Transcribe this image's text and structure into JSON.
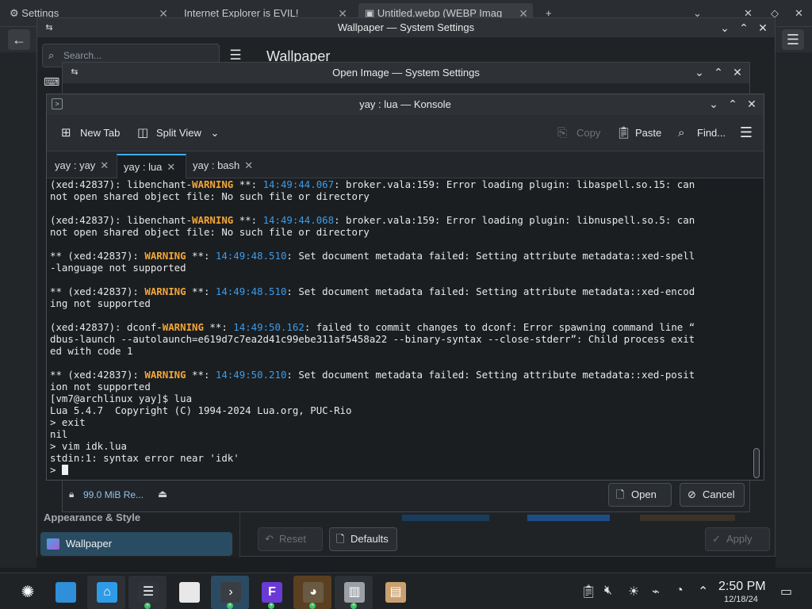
{
  "browser": {
    "tabs": [
      "Settings",
      "Internet Explorer is EVIL!",
      "Untitled.webp (WEBP Imag"
    ],
    "new_tab_label": "+"
  },
  "settings_window": {
    "title": "Wallpaper — System Settings",
    "search_placeholder": "Search...",
    "heading": "Wallpaper",
    "sidebar_category": "Appearance & Style",
    "sidebar_item": "Wallpaper",
    "reset_label": "Reset",
    "defaults_label": "Defaults",
    "apply_label": "Apply"
  },
  "open_dialog": {
    "title": "Open Image — System Settings",
    "status": "99.0 MiB Re...",
    "open_label": "Open",
    "cancel_label": "Cancel"
  },
  "konsole": {
    "title": "yay : lua — Konsole",
    "toolbar": {
      "new_tab": "New Tab",
      "split_view": "Split View",
      "copy": "Copy",
      "paste": "Paste",
      "find": "Find..."
    },
    "tabs": [
      "yay : yay",
      "yay : lua",
      "yay : bash"
    ],
    "active_tab": 1,
    "terminal": [
      [
        {
          "t": "(xed:42837): libenchant-",
          "c": ""
        },
        {
          "t": "WARNING",
          "c": "warn"
        },
        {
          "t": " **: ",
          "c": ""
        },
        {
          "t": "14:49:44.067",
          "c": "time"
        },
        {
          "t": ": broker.vala:159: Error loading plugin: libaspell.so.15: can",
          "c": ""
        }
      ],
      [
        {
          "t": "not open shared object file: No such file or directory",
          "c": ""
        }
      ],
      [],
      [
        {
          "t": "(xed:42837): libenchant-",
          "c": ""
        },
        {
          "t": "WARNING",
          "c": "warn"
        },
        {
          "t": " **: ",
          "c": ""
        },
        {
          "t": "14:49:44.068",
          "c": "time"
        },
        {
          "t": ": broker.vala:159: Error loading plugin: libnuspell.so.5: can",
          "c": ""
        }
      ],
      [
        {
          "t": "not open shared object file: No such file or directory",
          "c": ""
        }
      ],
      [],
      [
        {
          "t": "** (xed:42837): ",
          "c": ""
        },
        {
          "t": "WARNING",
          "c": "warn"
        },
        {
          "t": " **: ",
          "c": ""
        },
        {
          "t": "14:49:48.510",
          "c": "time"
        },
        {
          "t": ": Set document metadata failed: Setting attribute metadata::xed-spell",
          "c": ""
        }
      ],
      [
        {
          "t": "-language not supported",
          "c": ""
        }
      ],
      [],
      [
        {
          "t": "** (xed:42837): ",
          "c": ""
        },
        {
          "t": "WARNING",
          "c": "warn"
        },
        {
          "t": " **: ",
          "c": ""
        },
        {
          "t": "14:49:48.510",
          "c": "time"
        },
        {
          "t": ": Set document metadata failed: Setting attribute metadata::xed-encod",
          "c": ""
        }
      ],
      [
        {
          "t": "ing not supported",
          "c": ""
        }
      ],
      [],
      [
        {
          "t": "(xed:42837): dconf-",
          "c": ""
        },
        {
          "t": "WARNING",
          "c": "warn"
        },
        {
          "t": " **: ",
          "c": ""
        },
        {
          "t": "14:49:50.162",
          "c": "time"
        },
        {
          "t": ": failed to commit changes to dconf: Error spawning command line “",
          "c": ""
        }
      ],
      [
        {
          "t": "dbus-launch --autolaunch=e619d7c7ea2d41c99ebe311af5458a22 --binary-syntax --close-stderr”: Child process exit",
          "c": ""
        }
      ],
      [
        {
          "t": "ed with code 1",
          "c": ""
        }
      ],
      [],
      [
        {
          "t": "** (xed:42837): ",
          "c": ""
        },
        {
          "t": "WARNING",
          "c": "warn"
        },
        {
          "t": " **: ",
          "c": ""
        },
        {
          "t": "14:49:50.210",
          "c": "time"
        },
        {
          "t": ": Set document metadata failed: Setting attribute metadata::xed-posit",
          "c": ""
        }
      ],
      [
        {
          "t": "ion not supported",
          "c": ""
        }
      ],
      [
        {
          "t": "[vm7@archlinux yay]$ lua",
          "c": ""
        }
      ],
      [
        {
          "t": "Lua 5.4.7  Copyright (C) 1994-2024 Lua.org, PUC-Rio",
          "c": ""
        }
      ],
      [
        {
          "t": "> exit",
          "c": ""
        }
      ],
      [
        {
          "t": "nil",
          "c": ""
        }
      ],
      [
        {
          "t": "> vim idk.lua",
          "c": ""
        }
      ],
      [
        {
          "t": "stdin:1: syntax error near 'idk'",
          "c": ""
        }
      ],
      [
        {
          "t": "> ",
          "c": ""
        }
      ]
    ]
  },
  "taskbar": {
    "apps": [
      "launcher",
      "file-manager",
      "discover",
      "system-settings",
      "text-editor",
      "konsole",
      "app-f",
      "gimp",
      "archive",
      "package"
    ],
    "clock_time": "2:50 PM",
    "clock_date": "12/18/24"
  },
  "colors": {
    "warning": "#f4a636",
    "timestamp": "#3c9be8",
    "accent": "#3daee9",
    "selection": "#2a4c63"
  }
}
